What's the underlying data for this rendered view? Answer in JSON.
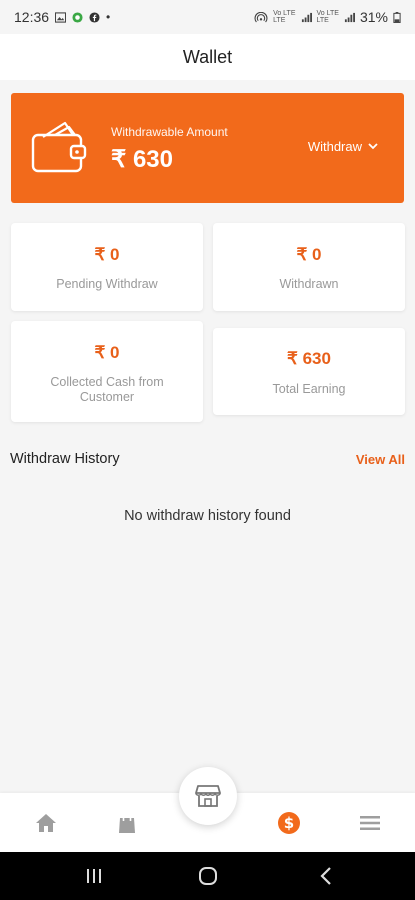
{
  "status_bar": {
    "time": "12:36",
    "dot": "•",
    "network_top": "Vo LTE",
    "network_bottom": "LTE",
    "battery": "31%",
    "icons": [
      "gallery-icon",
      "app-icon",
      "facebook-icon",
      "hotspot-icon",
      "signal-icon",
      "battery-icon"
    ]
  },
  "header": {
    "title": "Wallet"
  },
  "hero": {
    "label": "Withdrawable Amount",
    "amount": "₹ 630",
    "withdraw_label": "Withdraw",
    "color": "#f26a1b"
  },
  "stats": [
    {
      "value": "₹ 0",
      "label": "Pending Withdraw"
    },
    {
      "value": "₹ 0",
      "label": "Withdrawn"
    },
    {
      "value": "₹ 0",
      "label": "Collected Cash from Customer"
    },
    {
      "value": "₹ 630",
      "label": "Total Earning"
    }
  ],
  "history": {
    "title": "Withdraw History",
    "view_all": "View All",
    "empty_text": "No withdraw history found"
  },
  "bottom_nav": {
    "items": [
      "home-icon",
      "bag-icon",
      "store-icon",
      "dollar-icon",
      "menu-icon"
    ],
    "active": "dollar-icon",
    "active_color": "#f26a1b",
    "inactive_color": "#9e9e9e"
  },
  "system_nav": {
    "buttons": [
      "recents-icon",
      "home-circle-icon",
      "back-icon"
    ]
  }
}
